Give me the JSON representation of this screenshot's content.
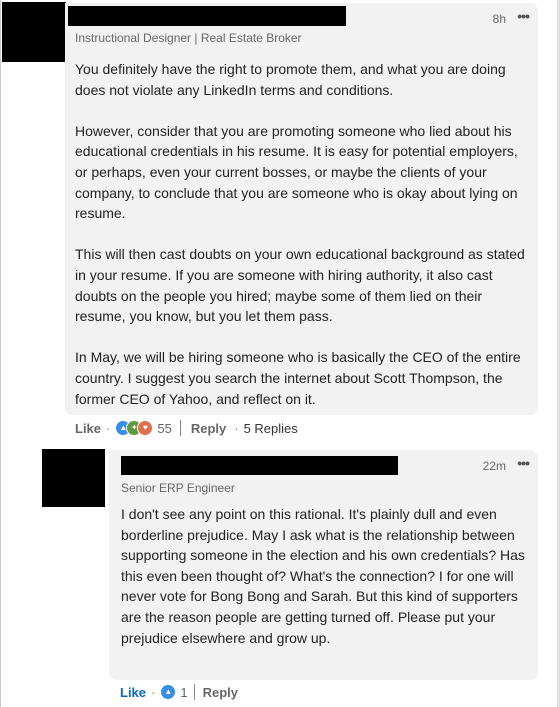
{
  "comment": {
    "time": "8h",
    "more": "•••",
    "headline": "Instructional Designer | Real Estate Broker",
    "paragraphs": [
      "You definitely have the right to promote them, and what you are doing does not violate any LinkedIn terms and conditions.",
      "However, consider that you are promoting someone who lied about his educational credentials in his resume. It is easy for potential employers, or perhaps, even your current bosses, or maybe the clients of your company, to conclude that you are someone who is okay about lying on resume.",
      "This will then cast doubts on your own educational background as stated in your resume. If you are someone with hiring authority, it also cast doubts on the people you hired; maybe some of them lied on their resume, you know, but you let them pass.",
      "In May, we will be hiring someone who is basically the CEO of the entire country. I suggest you search the internet about Scott Thompson, the former CEO of Yahoo, and reflect on it."
    ],
    "actions": {
      "like": "Like",
      "dot": "·",
      "reaction_count": "55",
      "reply": "Reply",
      "replies": "5 Replies",
      "reaction_icons": [
        "like-icon",
        "celebrate-icon",
        "love-icon"
      ]
    }
  },
  "reply": {
    "time": "22m",
    "more": "•••",
    "headline": "Senior ERP Engineer",
    "text": "I don't see any point on this rational. It's plainly dull and even borderline prejudice. May I ask what is the relationship between supporting someone in the election and his own credentials? Has this even been thought of? What's the connection? I for one will never vote for Bong Bong and Sarah. But this kind of supporters are the reason people are getting turned off. Please put your prejudice elsewhere and grow up.",
    "actions": {
      "like": "Like",
      "dot": "·",
      "reaction_count": "1",
      "reply": "Reply",
      "reaction_icons": [
        "like-icon"
      ]
    }
  },
  "colors": {
    "bubble": "#f2f2f2",
    "like_active": "#0a66c2",
    "like_reaction": "#378fe9",
    "celebrate_reaction": "#5f9b41",
    "love_reaction": "#df704d"
  }
}
